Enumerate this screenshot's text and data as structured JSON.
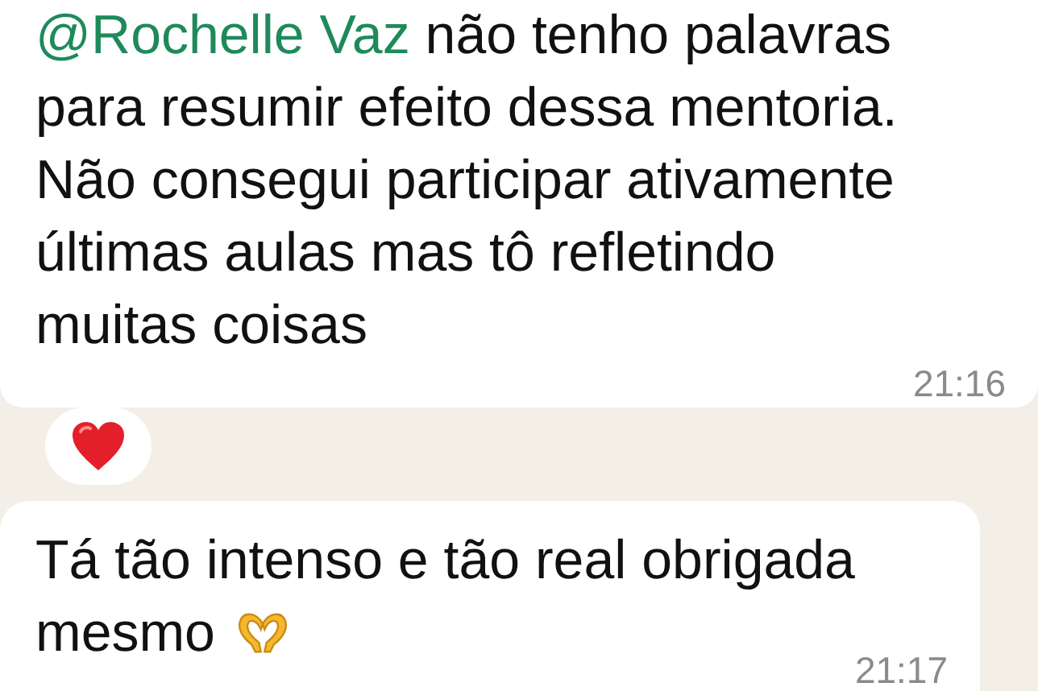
{
  "messages": [
    {
      "mention": "@Rochelle Vaz",
      "text": "não tenho palavras\npara resumir efeito dessa mentoria.\nNão consegui participar ativamente\núltimas aulas mas tô refletindo\nmuitas coisas",
      "time": "21:16",
      "reaction": {
        "kind": "heart"
      }
    },
    {
      "lines": [
        "Tá tão intenso e tão real obrigada",
        "mesmo"
      ],
      "emoji": {
        "kind": "heart-hands"
      },
      "time": "21:17"
    }
  ]
}
